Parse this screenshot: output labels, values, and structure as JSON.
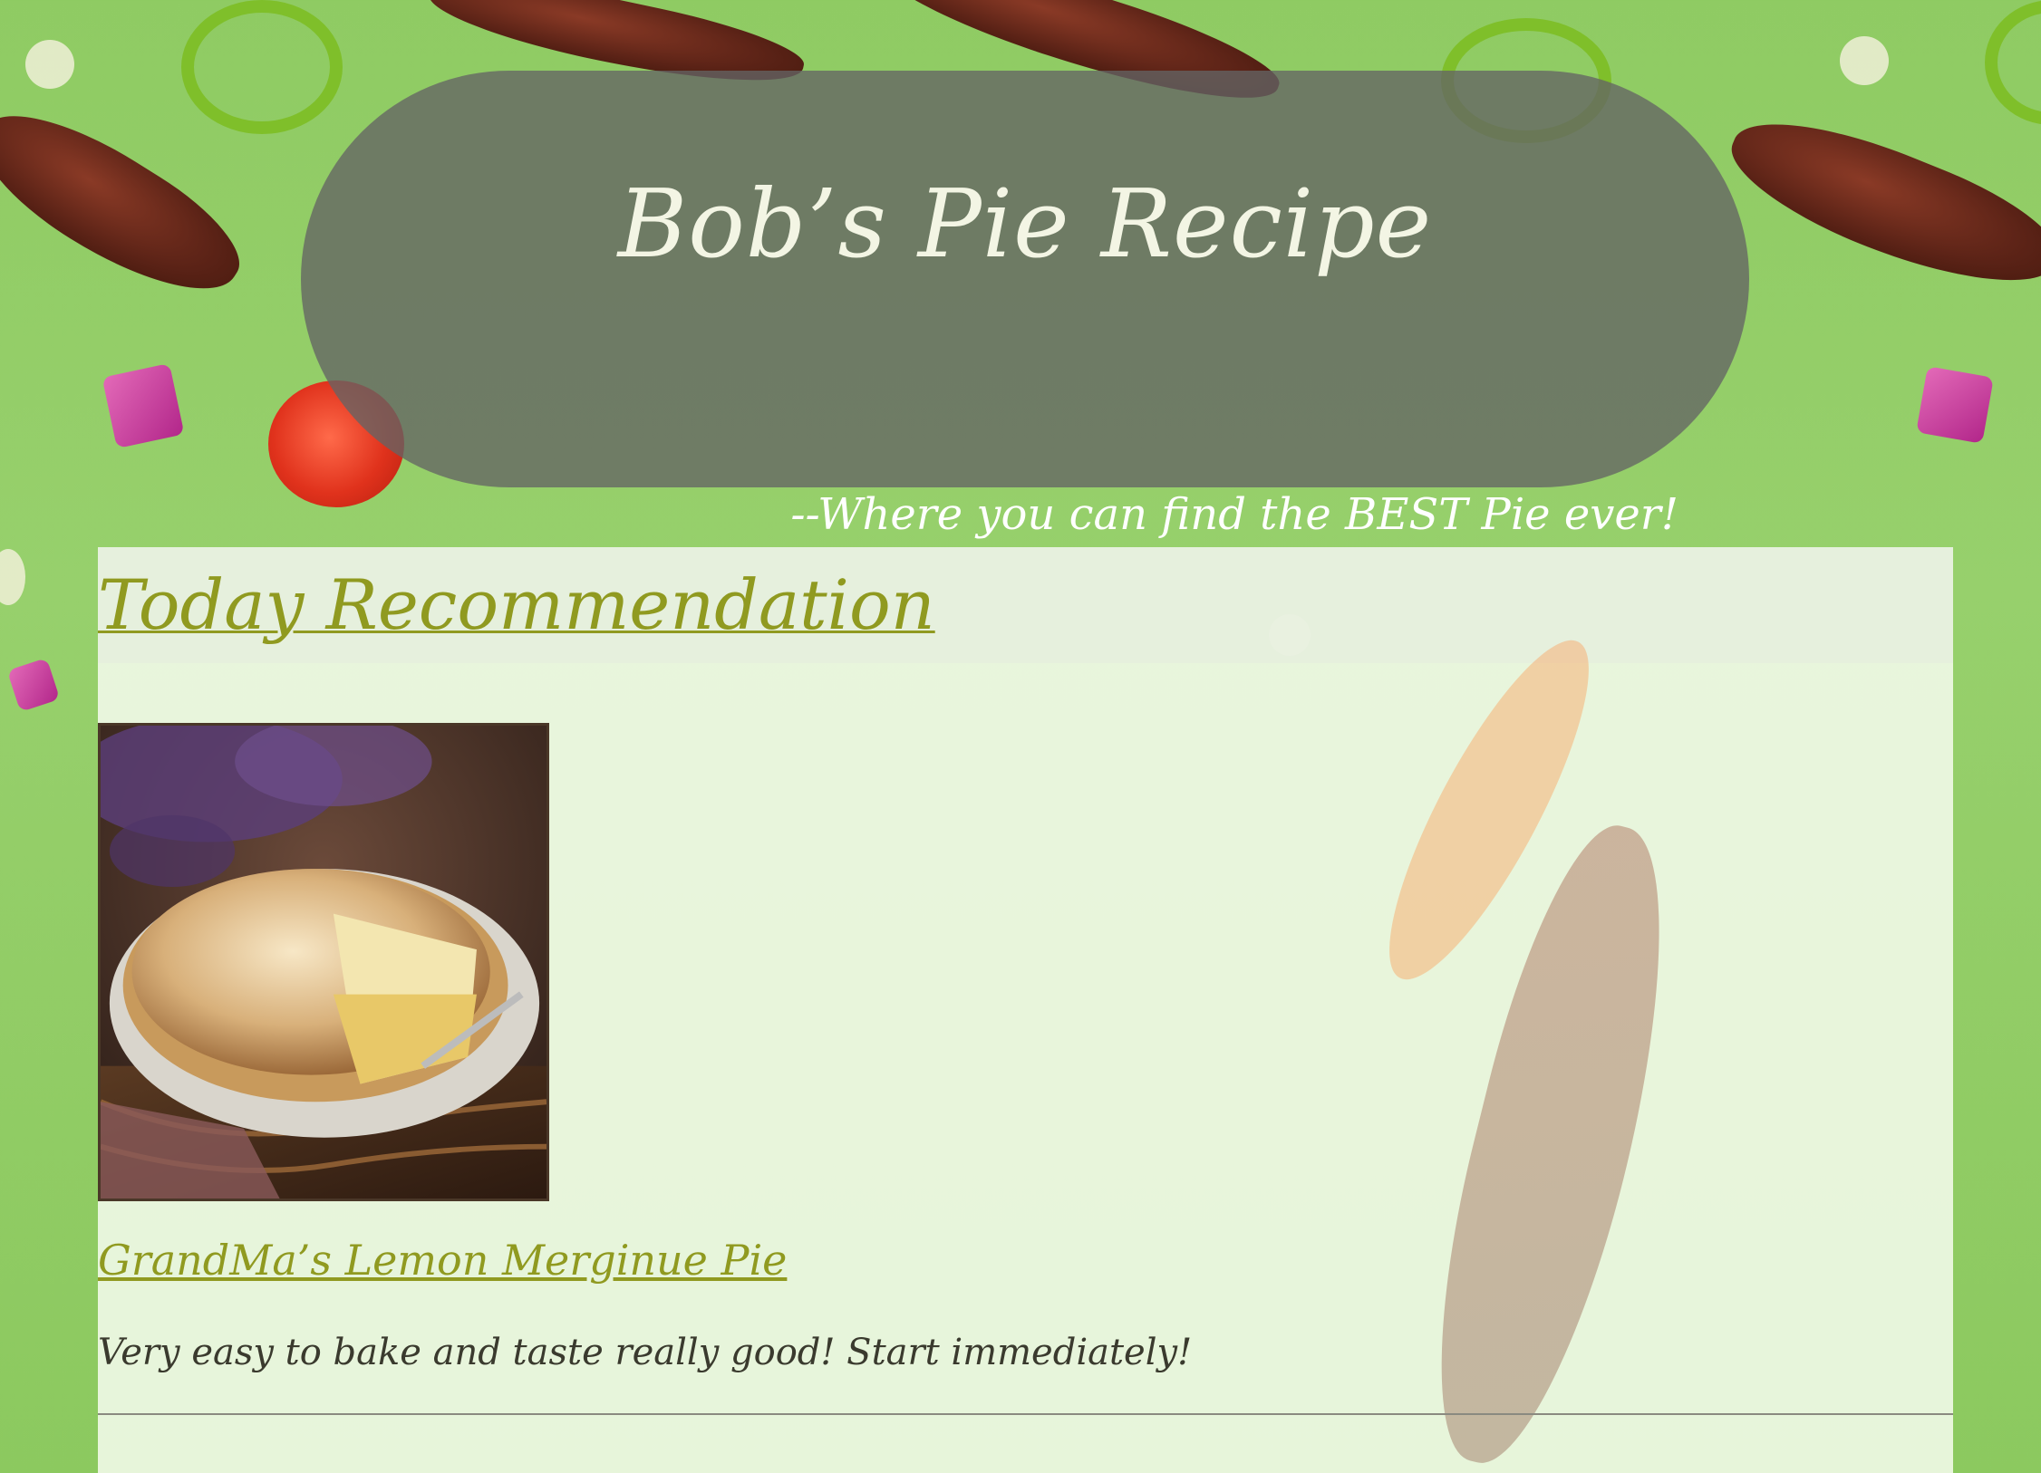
{
  "site": {
    "title": "Bob’s Pie Recipe",
    "tagline": "--Where you can find the BEST Pie ever!"
  },
  "recommendation": {
    "heading": "Today Recommendation",
    "recipe_title": "GrandMa’s Lemon Merginue Pie",
    "recipe_description": "Very easy to bake and taste really good! Start immediately!",
    "image_alt": "lemon meringue pie photo"
  },
  "colors": {
    "background": "#8fcb63",
    "header_pill": "#646464",
    "link": "#909a20",
    "text": "#3a3a2e"
  }
}
